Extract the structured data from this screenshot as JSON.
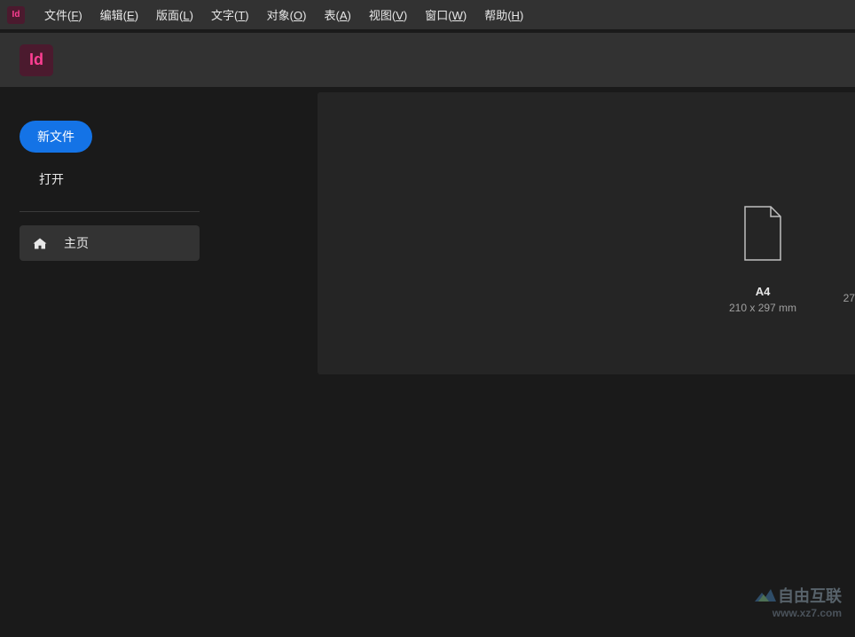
{
  "menubar": {
    "items": [
      {
        "label": "文件",
        "key": "F"
      },
      {
        "label": "编辑",
        "key": "E"
      },
      {
        "label": "版面",
        "key": "L"
      },
      {
        "label": "文字",
        "key": "T"
      },
      {
        "label": "对象",
        "key": "O"
      },
      {
        "label": "表",
        "key": "A"
      },
      {
        "label": "视图",
        "key": "V"
      },
      {
        "label": "窗口",
        "key": "W"
      },
      {
        "label": "帮助",
        "key": "H"
      }
    ]
  },
  "app": {
    "short_name": "Id"
  },
  "sidebar": {
    "new_file_label": "新文件",
    "open_label": "打开",
    "home_label": "主页"
  },
  "presets": {
    "a4": {
      "title": "A4",
      "dimensions": "210 x 297 mm"
    },
    "partial_next": "27"
  },
  "watermark": {
    "brand": "自由互联",
    "url": "www.xz7.com"
  }
}
